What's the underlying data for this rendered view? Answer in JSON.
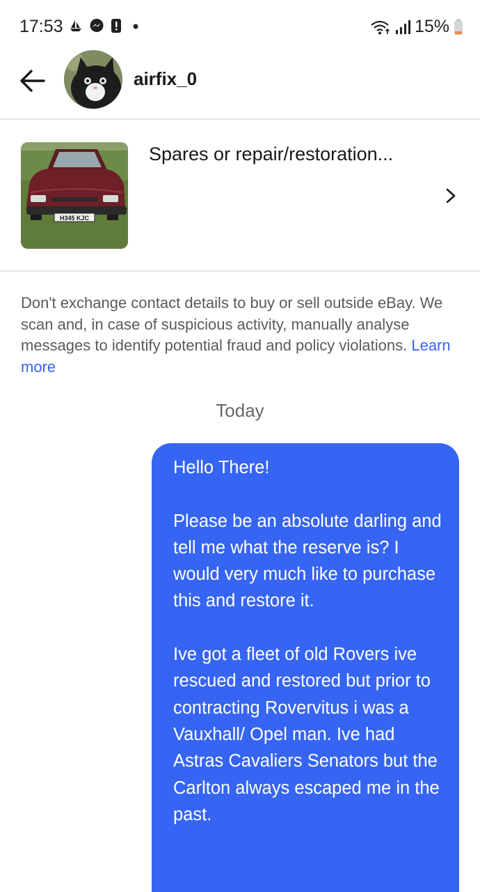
{
  "status_bar": {
    "time": "17:53",
    "battery": "15%",
    "left_icons": [
      "boat-notification-icon",
      "messenger-icon",
      "alert-icon",
      "dot-icon"
    ],
    "right_icons": [
      "wifi-icon",
      "signal-icon",
      "battery-icon"
    ]
  },
  "header": {
    "username": "airfix_0",
    "back_icon": "arrow-left-icon"
  },
  "listing": {
    "title": "Spares or repair/restoration...",
    "plate": "H345 KJC",
    "chevron_icon": "chevron-right-icon"
  },
  "notice": {
    "text": "Don't exchange contact details to buy or sell outside eBay. We scan and, in case of suspicious activity, manually analyse messages to identify potential fraud and policy violations.",
    "link": "Learn more"
  },
  "conversation": {
    "date_label": "Today",
    "messages": [
      {
        "paragraphs": [
          "Hello There!",
          "Please be an absolute darling and tell me what the reserve is? I would very much like to purchase this and restore it.",
          "Ive got a fleet of old Rovers ive rescued and restored but prior to contracting Rovervitus i was a Vauxhall/ Opel man. Ive had Astras Cavaliers Senators but the Carlton always escaped me in the past."
        ]
      }
    ]
  },
  "colors": {
    "accent": "#3665f3",
    "bubble_text": "#ffffff",
    "divider": "#e5e5e5",
    "notice_text": "#5a5a5a"
  }
}
